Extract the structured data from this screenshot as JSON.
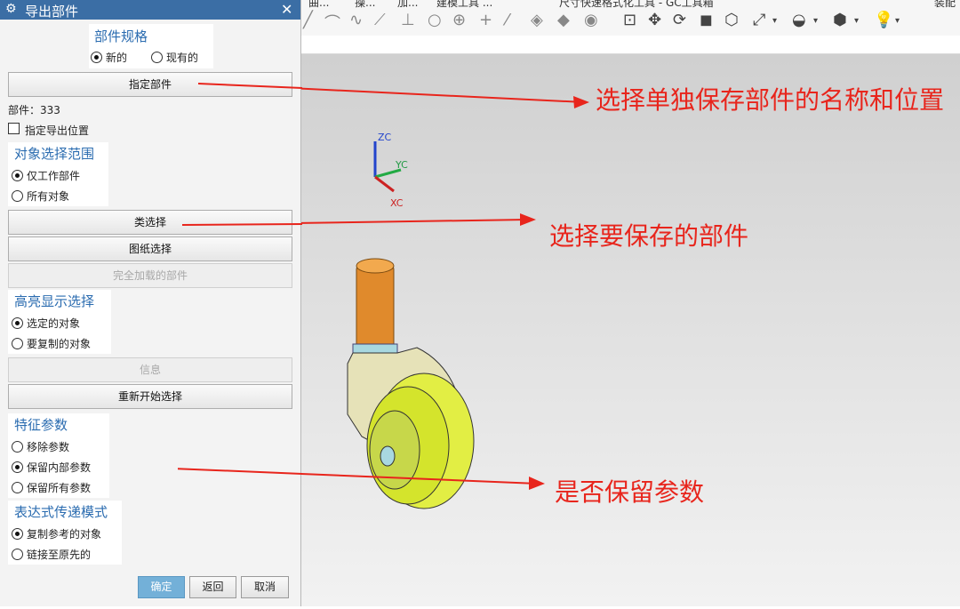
{
  "dialog": {
    "title": "导出部件",
    "part_spec": {
      "title": "部件规格",
      "options": [
        "新的",
        "现有的"
      ],
      "selected": "新的"
    },
    "specify_part_label": "指定部件",
    "part_info": "部件：333",
    "export_location_label": "指定导出位置",
    "object_scope": {
      "title": "对象选择范围",
      "options": [
        "仅工作部件",
        "所有对象"
      ],
      "selected": "仅工作部件"
    },
    "class_select_label": "类选择",
    "drawing_select_label": "图纸选择",
    "fully_loaded_label": "完全加载的部件",
    "highlight": {
      "title": "高亮显示选择",
      "options": [
        "选定的对象",
        "要复制的对象"
      ],
      "selected": "选定的对象"
    },
    "info_label": "信息",
    "restart_label": "重新开始选择",
    "feature_params": {
      "title": "特征参数",
      "options": [
        "移除参数",
        "保留内部参数",
        "保留所有参数"
      ],
      "selected": "保留内部参数"
    },
    "expr_mode": {
      "title": "表达式传递模式",
      "options": [
        "复制参考的对象",
        "链接至原先的"
      ],
      "selected": "复制参考的对象"
    },
    "ok_label": "确定",
    "back_label": "返回",
    "cancel_label": "取消"
  },
  "toolbar": {
    "groups": [
      "曲...",
      "操...",
      "加...",
      "建模工具 ...",
      "尺寸快速格式化工具 - GC工具箱",
      "装配"
    ]
  },
  "triad": {
    "z": "ZC",
    "y": "YC",
    "x": "XC"
  },
  "annotations": {
    "a1": "选择单独保存部件的名称和位置",
    "a2": "选择要保存的部件",
    "a3": "是否保留参数"
  },
  "colors": {
    "annotation": "#e8251c",
    "title_bar": "#3b6ea5",
    "group_title": "#2b6cb0"
  }
}
